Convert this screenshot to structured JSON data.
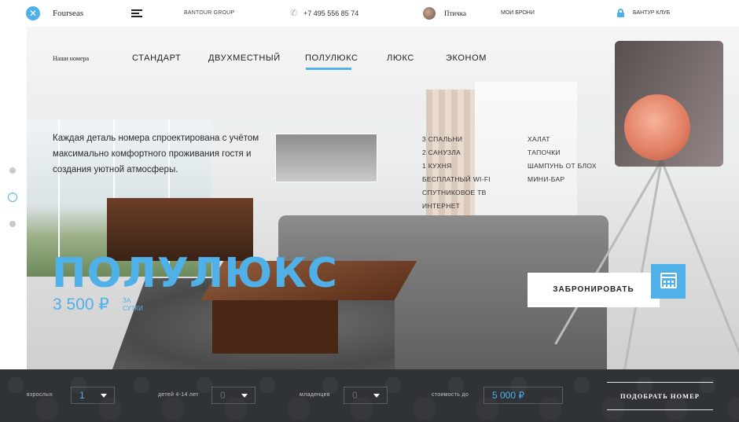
{
  "header": {
    "brand": "Fourseas",
    "group": "BANTOUR GROUP",
    "phone": "+7 495 556 85 74",
    "user_name": "Птичка",
    "bookings": "МОИ БРОНИ",
    "club": "БАНТУР КЛУБ"
  },
  "hero": {
    "nav_label": "Наши номера",
    "tabs": [
      {
        "label": "СТАНДАРТ",
        "active": false
      },
      {
        "label": "ДВУХМЕСТНЫЙ",
        "active": false
      },
      {
        "label": "ПОЛУЛЮКС",
        "active": true
      },
      {
        "label": "ЛЮКС",
        "active": false
      },
      {
        "label": "ЭКОНОМ",
        "active": false
      }
    ],
    "description": "Каждая деталь номера спроектирована с учётом максимально комфортного проживания гостя и создания уютной атмосферы.",
    "features_left": [
      "3 СПАЛЬНИ",
      "2 САНУЗЛА",
      "1 КУХНЯ",
      "БЕСПЛАТНЫЙ WI-FI",
      "СПУТНИКОВОЕ ТВ",
      "ИНТЕРНЕТ"
    ],
    "features_right": [
      "ХАЛАТ",
      "ТАПОЧКИ",
      "ШАМПУНЬ ОТ БЛОХ",
      "МИНИ-БАР"
    ],
    "room_title": "ПОЛУЛЮКС",
    "price": "3 500 ₽",
    "price_unit": "ЗА СУТКИ",
    "book_label": "ЗАБРОНИРОВАТЬ"
  },
  "search": {
    "adults_label": "взрослых",
    "adults_value": "1",
    "children_label": "детей 4-14 лет",
    "children_value": "0",
    "infants_label": "младенцев",
    "infants_value": "0",
    "cost_label": "стоимость до",
    "cost_value": "5 000 ₽",
    "submit_label": "ПОДОБРАТЬ НОМЕР"
  },
  "colors": {
    "accent": "#4fb1e8",
    "footer_bg": "#2f3237"
  },
  "icons": [
    "close-icon",
    "menu-icon",
    "phone-icon",
    "avatar",
    "lock-icon",
    "calendar-icon",
    "chevron-down-icon"
  ]
}
